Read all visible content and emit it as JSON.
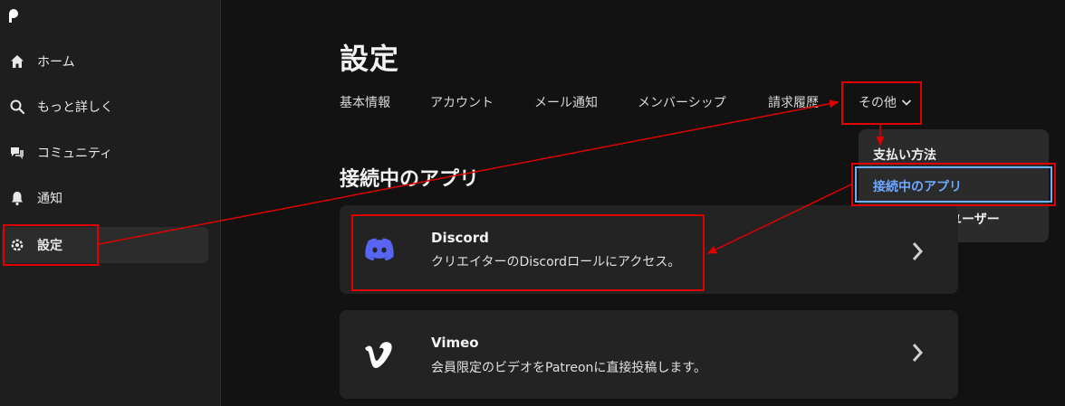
{
  "sidebar": {
    "items": [
      {
        "label": "ホーム",
        "icon": "home-icon"
      },
      {
        "label": "もっと詳しく",
        "icon": "search-icon"
      },
      {
        "label": "コミュニティ",
        "icon": "chat-icon"
      },
      {
        "label": "通知",
        "icon": "bell-icon"
      },
      {
        "label": "設定",
        "icon": "gear-icon",
        "active": true
      }
    ]
  },
  "page": {
    "title": "設定",
    "tabs": [
      "基本情報",
      "アカウント",
      "メール通知",
      "メンバーシップ",
      "請求履歴"
    ],
    "more_tab": "その他"
  },
  "dropdown": {
    "items": [
      "支払い方法",
      "接続中のアプリ",
      "ブロックしたユーザー"
    ],
    "selected_index": 1
  },
  "section": {
    "title": "接続中のアプリ"
  },
  "apps": [
    {
      "name": "Discord",
      "description": "クリエイターのDiscordロールにアクセス。",
      "icon": "discord-icon"
    },
    {
      "name": "Vimeo",
      "description": "会員限定のビデオをPatreonに直接投稿します。",
      "icon": "vimeo-icon"
    }
  ],
  "colors": {
    "background": "#121212",
    "sidebar": "#1e1e1e",
    "card": "#232323",
    "annotation": "#e00000",
    "selected": "#6ea8ff",
    "discord": "#5865f2"
  }
}
